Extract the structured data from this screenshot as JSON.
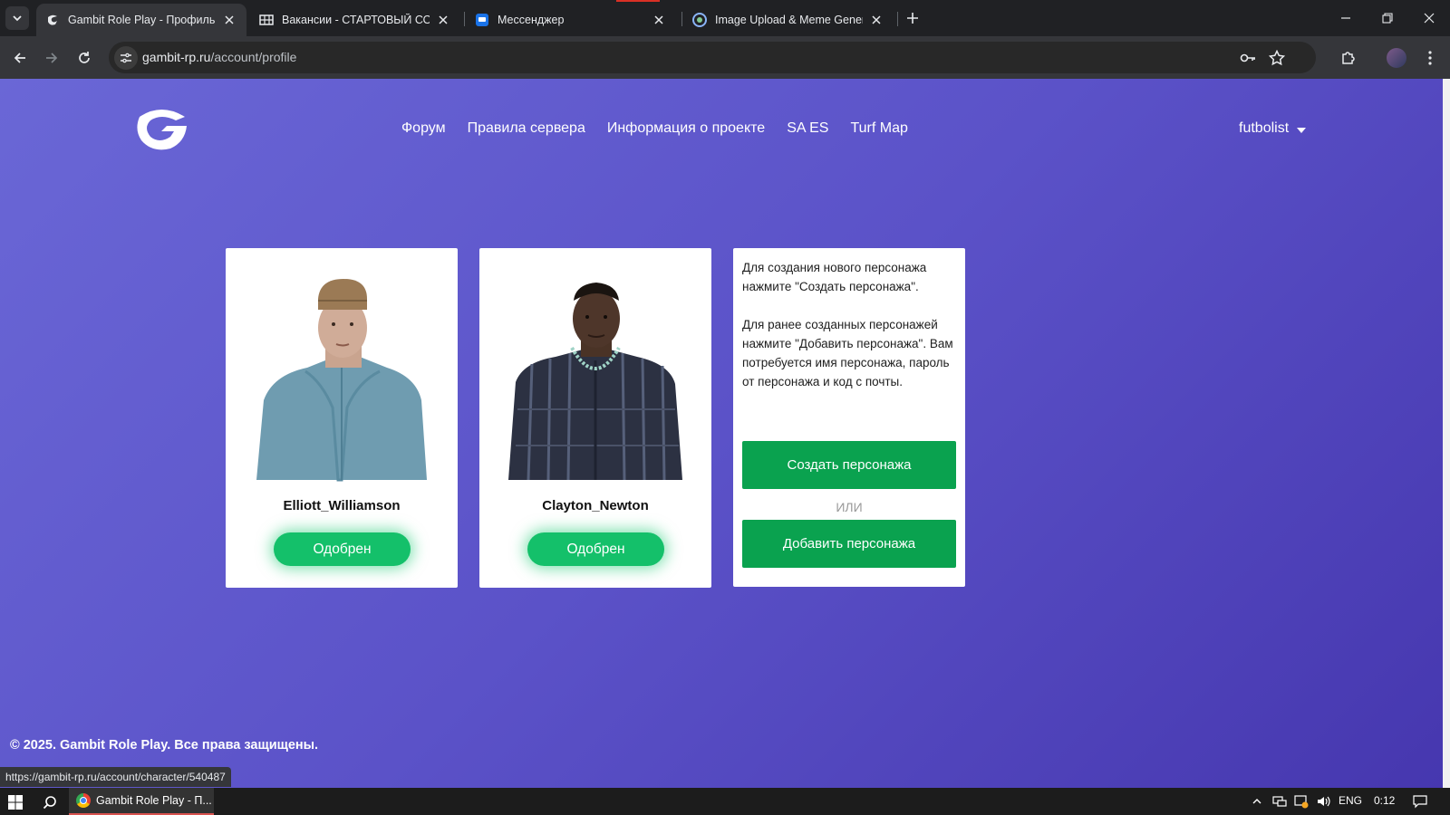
{
  "browser": {
    "tabs": [
      {
        "title": "Gambit Role Play - Профиль UCP",
        "active": true
      },
      {
        "title": "Вакансии - СТАРТОВЫЙ СОСТАВ",
        "active": false
      },
      {
        "title": "Мессенджер",
        "active": false
      },
      {
        "title": "Image Upload & Meme Generator",
        "active": false
      }
    ],
    "url_host": "gambit-rp.ru",
    "url_path": "/account/profile"
  },
  "site": {
    "nav": [
      "Форум",
      "Правила сервера",
      "Информация о проекте",
      "SA ES",
      "Turf Map"
    ],
    "username": "futbolist"
  },
  "characters": [
    {
      "name": "Elliott_Williamson",
      "status": "Одобрен",
      "portrait": "white-man-blue-shirt"
    },
    {
      "name": "Clayton_Newton",
      "status": "Одобрен",
      "portrait": "black-man-plaid-shirt-chain"
    }
  ],
  "info": {
    "paragraph1": "Для создания нового персонажа нажмите \"Создать персонажа\".",
    "paragraph2": "Для ранее созданных персонажей нажмите \"Добавить персонажа\". Вам потребуется имя персонажа, пароль от персонажа и код с почты.",
    "create_button": "Создать персонажа",
    "or_text": "ИЛИ",
    "add_button": "Добавить персонажа"
  },
  "footer": {
    "copyright": "© 2025. Gambit Role Play. Все права защищены."
  },
  "status_bar_url": "https://gambit-rp.ru/account/character/540487",
  "taskbar": {
    "app_label": "Gambit Role Play - П...",
    "language": "ENG",
    "time": "0:12"
  },
  "colors": {
    "page_gradient_start": "#6a67d6",
    "page_gradient_end": "#4637af",
    "approved_green": "#14c06a",
    "action_green": "#0aa24f"
  }
}
